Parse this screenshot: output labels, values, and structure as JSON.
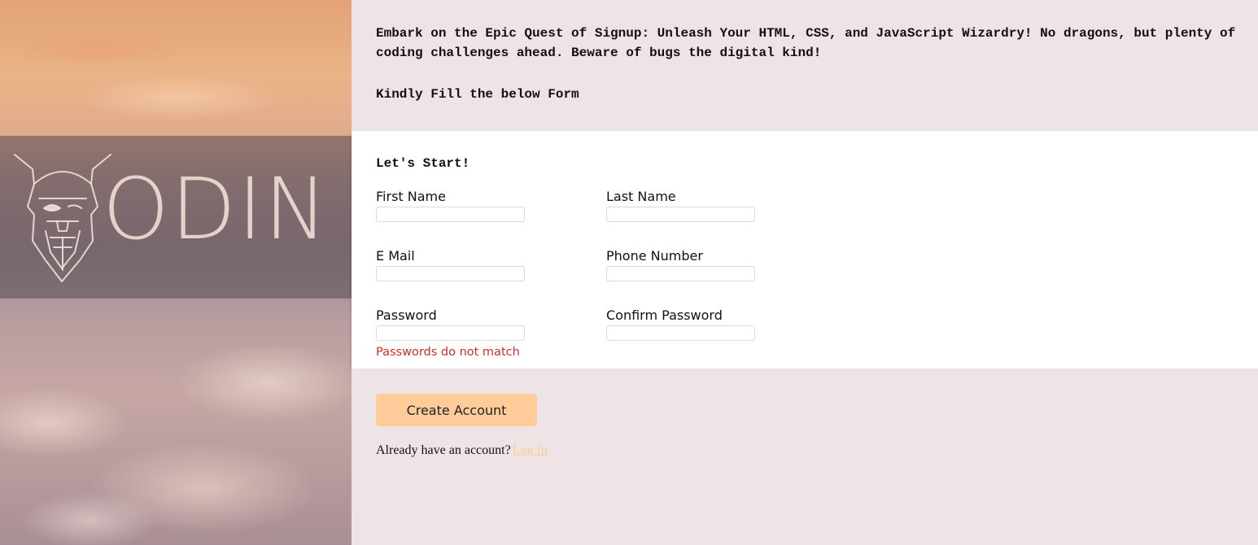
{
  "hero": {
    "wordmark": "ODIN",
    "logo_icon": "odin-viking-head-icon"
  },
  "intro": {
    "text": "Embark on the Epic Quest of Signup: Unleash Your HTML, CSS, and JavaScript Wizardry! No dragons, but plenty of coding challenges ahead. Beware of bugs the digital kind!",
    "prompt": "Kindly Fill the below Form"
  },
  "form": {
    "heading": "Let's Start!",
    "first_name": {
      "label": "First Name",
      "value": ""
    },
    "last_name": {
      "label": "Last Name",
      "value": ""
    },
    "email": {
      "label": "E Mail",
      "value": ""
    },
    "phone": {
      "label": "Phone Number",
      "value": ""
    },
    "password": {
      "label": "Password",
      "value": ""
    },
    "confirm_password": {
      "label": "Confirm Password",
      "value": ""
    },
    "password_error": "Passwords do not match"
  },
  "actions": {
    "create_label": "Create Account",
    "login_prompt": "Already have an account?",
    "login_link": "Log In"
  },
  "colors": {
    "accent": "#ffcc99",
    "panel_background": "#eee4e6",
    "form_background": "#ffffff",
    "error": "#d42a2a"
  }
}
